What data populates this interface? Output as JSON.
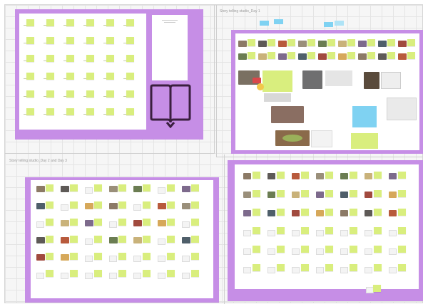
{
  "boards": [
    {
      "id": "board-calendar",
      "title": ""
    },
    {
      "id": "board-day1",
      "title": "Story telling studio_Day 1"
    },
    {
      "id": "board-day2-3",
      "title": "Story telling studio_Day 2 and Day 3"
    },
    {
      "id": "board-day4",
      "title": ""
    }
  ],
  "calendar_side_note": "",
  "book_icon": "open-book-icon",
  "colors": {
    "frame_purple": "#c68ee6",
    "sticky_green": "#d9ee7e",
    "sticky_blue": "#7fd2f2",
    "canvas_grid": "#f6f6f6",
    "book_outline": "#3a1f3f"
  }
}
